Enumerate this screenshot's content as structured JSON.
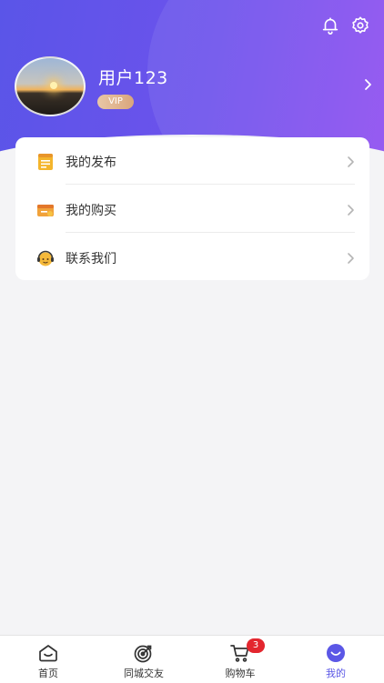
{
  "profile": {
    "username": "用户123",
    "vip_label": "VIP"
  },
  "header": {
    "icons": [
      "bell-icon",
      "gear-icon",
      "chevron-right-icon"
    ]
  },
  "menu": {
    "items": [
      {
        "label": "我的发布",
        "icon": "notepad-icon"
      },
      {
        "label": "我的购买",
        "icon": "purchase-box-icon"
      },
      {
        "label": "联系我们",
        "icon": "customer-service-icon"
      }
    ]
  },
  "tabbar": {
    "items": [
      {
        "label": "首页",
        "icon": "home-icon"
      },
      {
        "label": "同城交友",
        "icon": "target-icon"
      },
      {
        "label": "购物车",
        "icon": "cart-icon",
        "badge": "3"
      },
      {
        "label": "我的",
        "icon": "smile-face-icon",
        "active": true
      }
    ]
  },
  "colors": {
    "accent": "#5b57e6",
    "header_gradient_start": "#5a55e8",
    "header_gradient_end": "#8e4ef0",
    "badge": "#e3262e",
    "vip": "#d9a57c"
  }
}
